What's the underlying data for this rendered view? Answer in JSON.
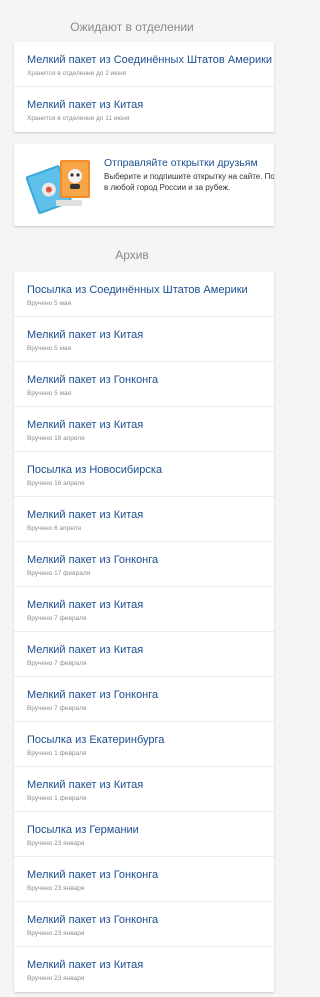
{
  "pending": {
    "heading": "Ожидают в отделении",
    "items": [
      {
        "title": "Мелкий пакет из Соединённых Штатов Америки",
        "subtitle": "Хранится в отделении до 2 июня"
      },
      {
        "title": "Мелкий пакет из Китая",
        "subtitle": "Хранится в отделении до 11 июня"
      }
    ]
  },
  "promo": {
    "title": "Отправляйте открытки друзьям",
    "text": "Выберите и подпишите открытку на сайте. Почта доставит ваше поздравление в любой город России и за рубеж.",
    "icon": "postcards-illustration"
  },
  "archive": {
    "heading": "Архив",
    "items": [
      {
        "title": "Посылка из Соединённых Штатов Америки",
        "subtitle": "Вручено 5 мая"
      },
      {
        "title": "Мелкий пакет из Китая",
        "subtitle": "Вручено 5 мая"
      },
      {
        "title": "Мелкий пакет из Гонконга",
        "subtitle": "Вручено 5 мая"
      },
      {
        "title": "Мелкий пакет из Китая",
        "subtitle": "Вручено 16 апреля"
      },
      {
        "title": "Посылка из Новосибирска",
        "subtitle": "Вручено 16 апреля"
      },
      {
        "title": "Мелкий пакет из Китая",
        "subtitle": "Вручено 6 апреля"
      },
      {
        "title": "Мелкий пакет из Гонконга",
        "subtitle": "Вручено 17 февраля"
      },
      {
        "title": "Мелкий пакет из Китая",
        "subtitle": "Вручено 7 февраля"
      },
      {
        "title": "Мелкий пакет из Китая",
        "subtitle": "Вручено 7 февраля"
      },
      {
        "title": "Мелкий пакет из Гонконга",
        "subtitle": "Вручено 7 февраля"
      },
      {
        "title": "Посылка из Екатеринбурга",
        "subtitle": "Вручено 1 февраля"
      },
      {
        "title": "Мелкий пакет из Китая",
        "subtitle": "Вручено 1 февраля"
      },
      {
        "title": "Посылка из Германии",
        "subtitle": "Вручено 23 января"
      },
      {
        "title": "Мелкий пакет из Гонконга",
        "subtitle": "Вручено 23 января"
      },
      {
        "title": "Мелкий пакет из Гонконга",
        "subtitle": "Вручено 23 января"
      },
      {
        "title": "Мелкий пакет из Китая",
        "subtitle": "Вручено 23 января"
      }
    ]
  },
  "colors": {
    "link": "#1d4f91",
    "muted": "#8d8d8d",
    "background": "#f5f5f5"
  }
}
